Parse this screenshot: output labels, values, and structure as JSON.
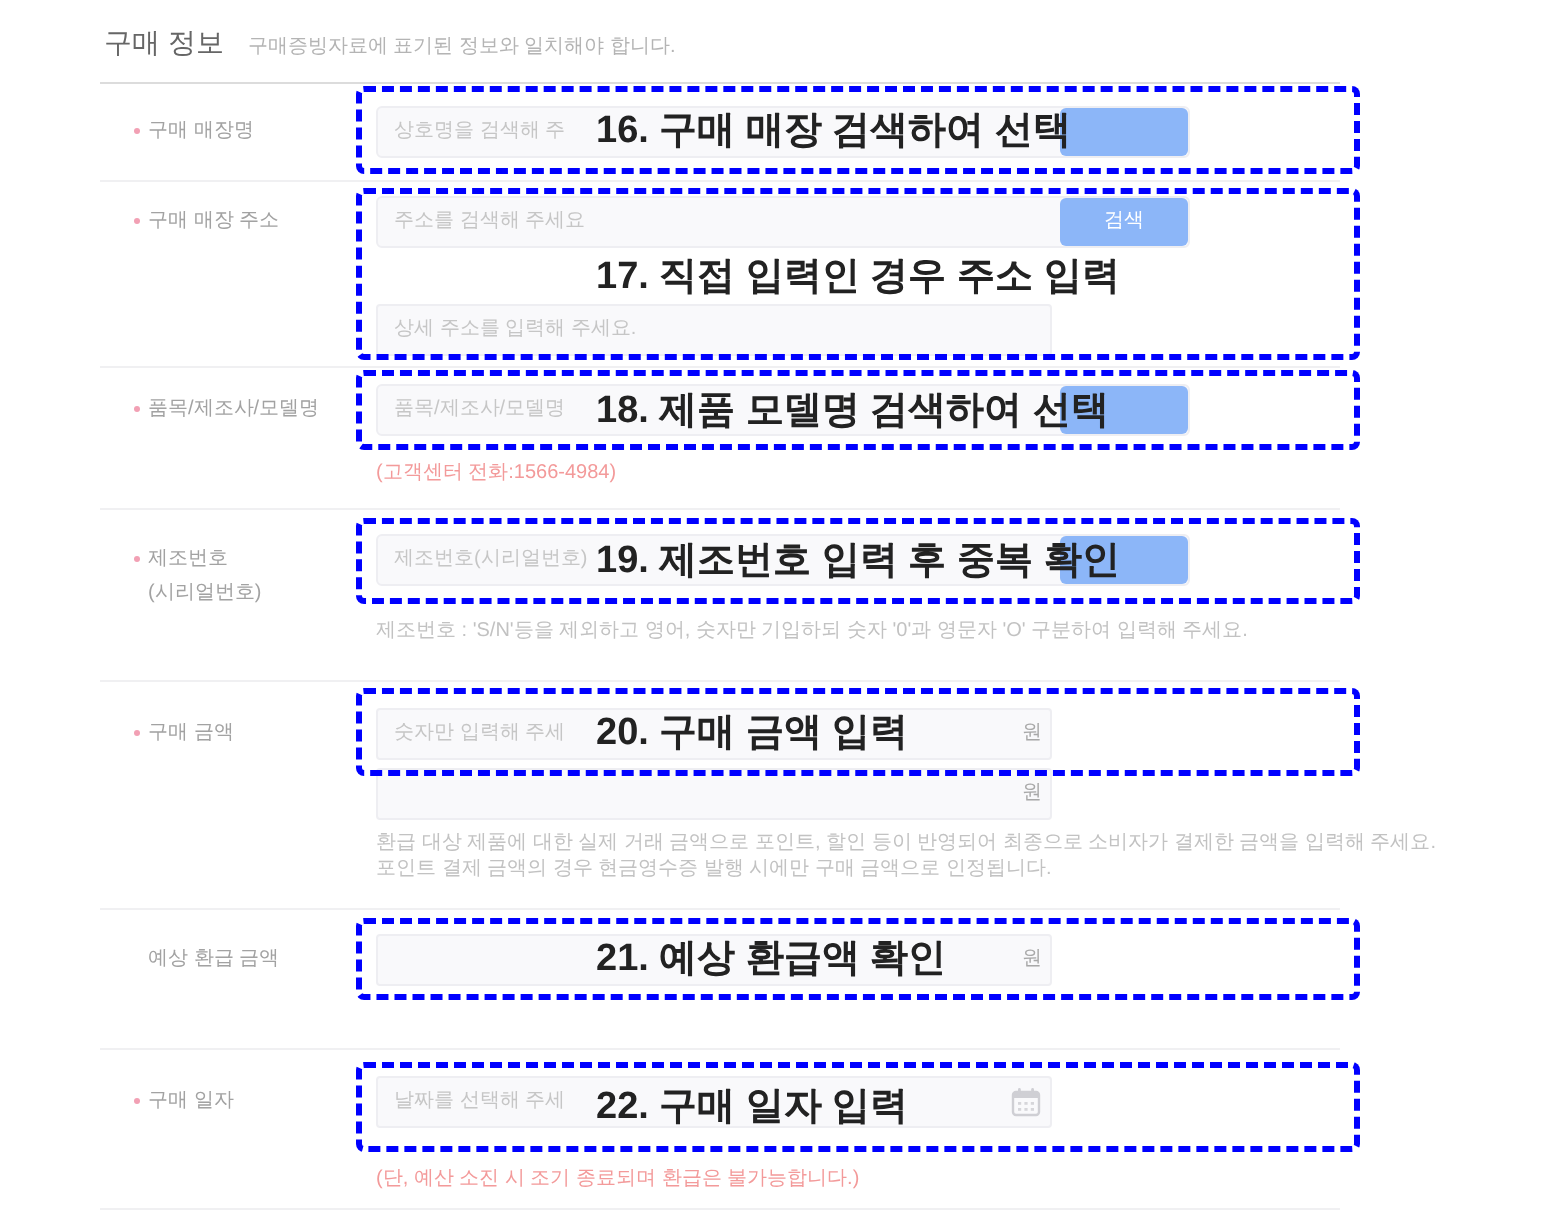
{
  "section": {
    "title": "구매 정보",
    "subtitle": "구매증빙자료에 표기된 정보와 일치해야 합니다."
  },
  "rows": [
    {
      "label": "구매 매장명",
      "required": true,
      "fields": [
        {
          "kind": "search",
          "placeholder": "상호명을 검색해 주"
        }
      ],
      "annotation": "16. 구매 매장 검색하여 선택"
    },
    {
      "label": "구매 매장 주소",
      "required": true,
      "fields": [
        {
          "kind": "search",
          "placeholder": "주소를 검색해 주세요",
          "button_label": "검색"
        },
        {
          "kind": "text",
          "placeholder": "상세 주소를 입력해 주세요."
        }
      ],
      "annotation": "17. 직접 입력인 경우 주소 입력"
    },
    {
      "label": "품목/제조사/모델명",
      "required": true,
      "fields": [
        {
          "kind": "search",
          "placeholder": "품목/제조사/모델명"
        }
      ],
      "notes": [
        {
          "kind": "warning",
          "text": "(고객센터 전화:1566-4984)"
        }
      ],
      "annotation": "18. 제품 모델명 검색하여 선택"
    },
    {
      "label": "제조번호\n(시리얼번호)",
      "required": true,
      "fields": [
        {
          "kind": "search",
          "placeholder": "제조번호(시리얼번호)"
        }
      ],
      "notes": [
        {
          "kind": "info",
          "text": "제조번호 : 'S/N'등을 제외하고 영어, 숫자만 기입하되 숫자 '0'과 영문자 'O' 구분하여 입력해 주세요."
        }
      ],
      "annotation": "19. 제조번호 입력 후 중복 확인"
    },
    {
      "label": "구매 금액",
      "required": true,
      "fields": [
        {
          "kind": "amount",
          "placeholder": "숫자만 입력해 주세",
          "unit": "원"
        },
        {
          "kind": "amount",
          "unit": "원"
        }
      ],
      "notes": [
        {
          "kind": "info",
          "text": "환급 대상 제품에 대한 실제 거래 금액으로 포인트, 할인 등이 반영되어 최종으로 소비자가 결제한 금액을 입력해 주세요."
        },
        {
          "kind": "info",
          "text": "포인트 결제 금액의 경우 현금영수증 발행 시에만 구매 금액으로 인정됩니다."
        }
      ],
      "annotation": "20. 구매 금액 입력"
    },
    {
      "label": "예상 환급 금액",
      "required": false,
      "fields": [
        {
          "kind": "amount",
          "unit": "원"
        }
      ],
      "annotation": "21. 예상 환급액 확인"
    },
    {
      "label": "구매 일자",
      "required": true,
      "fields": [
        {
          "kind": "date",
          "placeholder": "날짜를 선택해 주세"
        }
      ],
      "notes": [
        {
          "kind": "warning",
          "text": "(단, 예산 소진 시 조기 종료되며 환급은 불가능합니다.)"
        }
      ],
      "annotation": "22. 구매 일자 입력"
    }
  ]
}
